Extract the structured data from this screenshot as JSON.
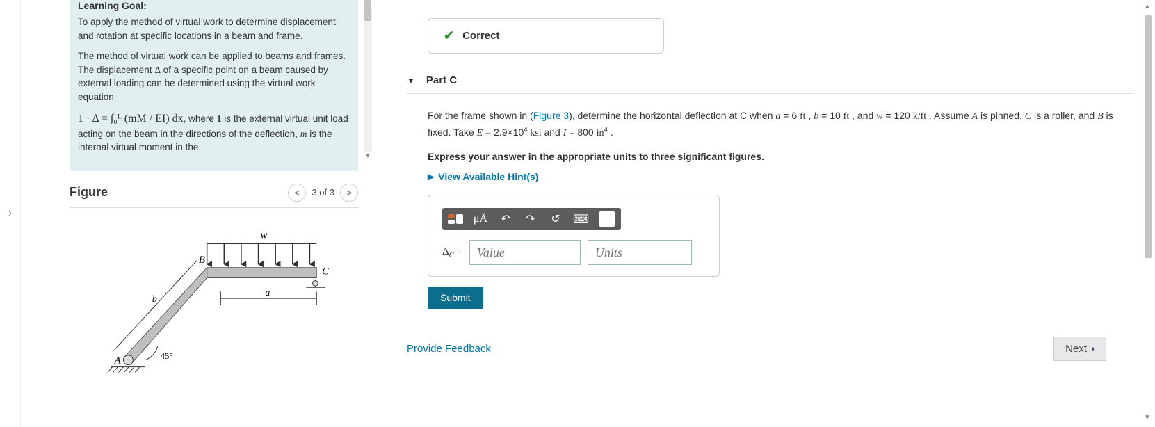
{
  "left": {
    "learning_goal_title": "Learning Goal:",
    "goal_p1": "To apply the method of virtual work to determine displacement and rotation at specific locations in a beam and frame.",
    "goal_p2_before": "The method of virtual work can be applied to beams and frames. The displacement ",
    "goal_p2_delta": "Δ",
    "goal_p2_after": " of a specific point on a beam caused by external loading can be determined using the virtual work equation",
    "eq_text": "1 · Δ = ∫₀ᴸ (mM / EI) dx",
    "eq_after_1": ", where ",
    "eq_bold1": "1",
    "eq_after_2": " is the external virtual unit load acting on the beam in the directions of the deflection, ",
    "eq_m": "m",
    "eq_after_3": " is the internal virtual moment in the",
    "figure_heading": "Figure",
    "pager_text": "3 of 3",
    "pager_prev": "<",
    "pager_next": ">",
    "diagram": {
      "w": "w",
      "B": "B",
      "C": "C",
      "a": "a",
      "b": "b",
      "A": "A",
      "angle": "45°"
    }
  },
  "right": {
    "correct_label": "Correct",
    "part_label": "Part C",
    "prompt_t1": "For the frame shown in (",
    "fig_link": "Figure 3",
    "prompt_t2": "), determine the horizontal deflection at C when ",
    "var_a": "a",
    "val_a": " = 6 ",
    "unit_ft1": "ft",
    "sep1": " , ",
    "var_b": "b",
    "val_b": " = 10 ",
    "unit_ft2": "ft",
    "sep2": " , and ",
    "var_w": "w",
    "val_w": " = 120 ",
    "unit_w": "k/ft",
    "prompt_t3_a": " . Assume ",
    "pA": "A",
    "t_pin": " is pinned, ",
    "pC": "C",
    "t_roll": " is a roller, and ",
    "pB": "B",
    "t_fix": " is fixed. Take ",
    "var_E": "E",
    "val_E": " = 2.9×10",
    "E_exp": "4",
    "unit_E": " ksi",
    "t_and": " and ",
    "var_I": "I",
    "val_I": " = 800 ",
    "unit_I_pre": "in",
    "I_exp": "4",
    "period": " .",
    "instruction": "Express your answer in the appropriate units to three significant figures.",
    "hints_label": "View Available Hint(s)",
    "toolbar": {
      "mu": "μÅ",
      "undo": "↶",
      "redo": "↷",
      "reset": "↺",
      "kbd": "⌨",
      "help": "?"
    },
    "answer_label_sym": "Δ",
    "answer_label_sub": "C",
    "answer_label_eq": " = ",
    "value_ph": "Value",
    "units_ph": "Units",
    "submit": "Submit",
    "provide_feedback": "Provide Feedback",
    "next": "Next"
  }
}
